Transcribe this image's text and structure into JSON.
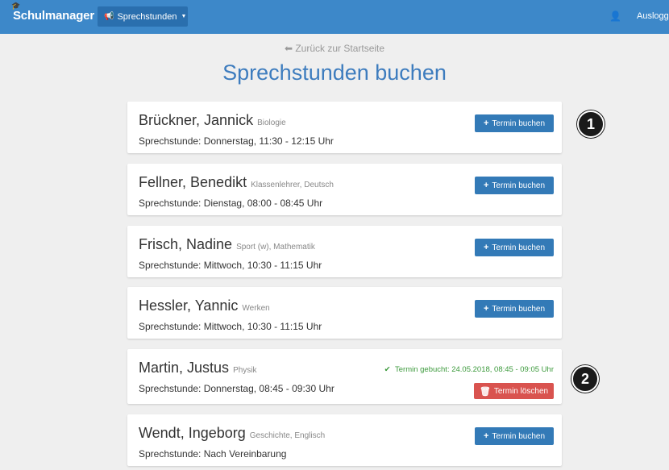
{
  "navbar": {
    "brand": "Schulmanager",
    "dropdown_label": "Sprechstunden",
    "logout_label": "Ausloggen"
  },
  "header": {
    "back_link": "Zurück zur Startseite",
    "title": "Sprechstunden buchen"
  },
  "teachers": [
    {
      "name": "Brückner, Jannick",
      "subjects": "Biologie",
      "time": "Sprechstunde: Donnerstag, 11:30 - 12:15 Uhr",
      "action": "Termin buchen"
    },
    {
      "name": "Fellner, Benedikt",
      "subjects": "Klassenlehrer, Deutsch",
      "time": "Sprechstunde: Dienstag, 08:00 - 08:45 Uhr",
      "action": "Termin buchen"
    },
    {
      "name": "Frisch, Nadine",
      "subjects": "Sport (w), Mathematik",
      "time": "Sprechstunde: Mittwoch, 10:30 - 11:15 Uhr",
      "action": "Termin buchen"
    },
    {
      "name": "Hessler, Yannic",
      "subjects": "Werken",
      "time": "Sprechstunde: Mittwoch, 10:30 - 11:15 Uhr",
      "action": "Termin buchen"
    },
    {
      "name": "Martin, Justus",
      "subjects": "Physik",
      "time": "Sprechstunde: Donnerstag, 08:45 - 09:30 Uhr",
      "booked_note": "Termin gebucht: 24.05.2018, 08:45 - 09:05 Uhr",
      "delete_label": "Termin löschen"
    },
    {
      "name": "Wendt, Ingeborg",
      "subjects": "Geschichte, Englisch",
      "time": "Sprechstunde: Nach Vereinbarung",
      "action": "Termin buchen"
    }
  ],
  "markers": [
    "1",
    "2"
  ],
  "colors": {
    "navbar": "#3d88c9",
    "title": "#3d7cbe",
    "book_button": "#337ab7",
    "delete_button": "#d9534f",
    "booked_text": "#3c9a3c"
  }
}
